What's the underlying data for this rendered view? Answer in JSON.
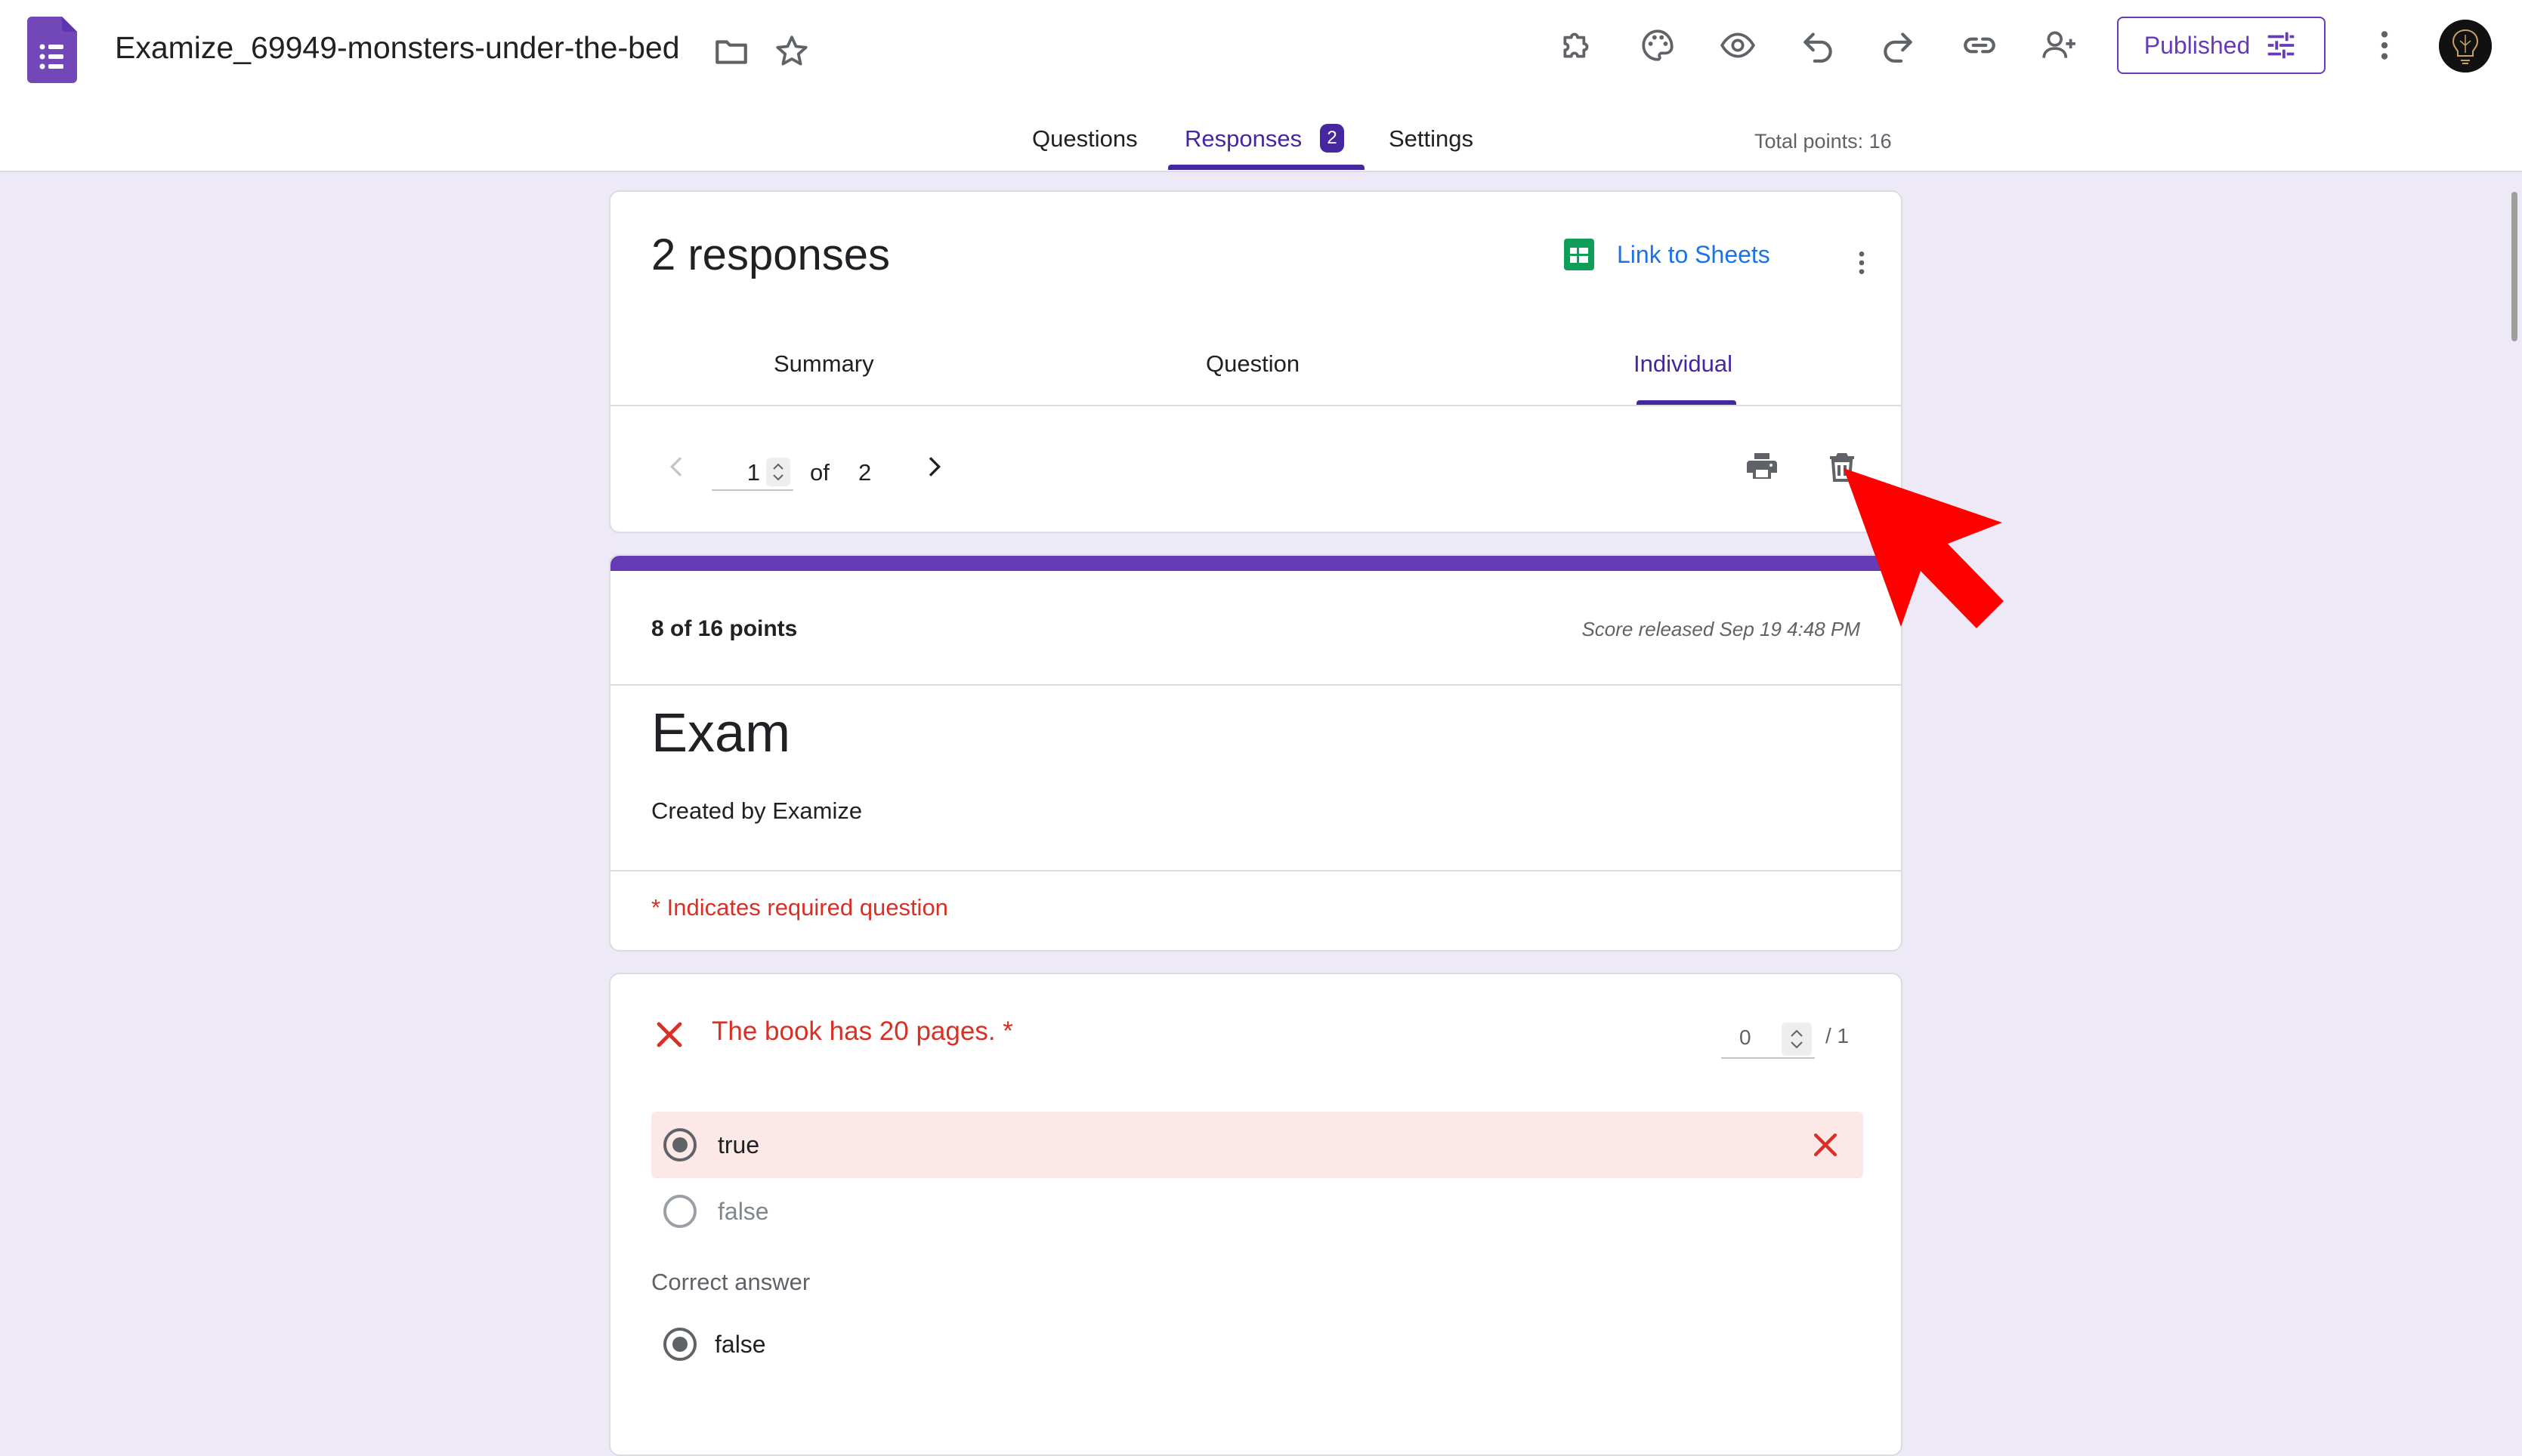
{
  "header": {
    "doc_title": "Examize_69949-monsters-under-the-bed",
    "published_label": "Published",
    "total_points": "Total points: 16"
  },
  "tabs": [
    {
      "label": "Questions"
    },
    {
      "label": "Responses",
      "badge": "2"
    },
    {
      "label": "Settings"
    }
  ],
  "responses_card": {
    "title": "2 responses",
    "link_sheets": "Link to Sheets",
    "subtabs": [
      "Summary",
      "Question",
      "Individual"
    ],
    "active_subtab": "Individual",
    "pager": {
      "current": "1",
      "of_label": "of",
      "total": "2"
    }
  },
  "score_card": {
    "points": "8 of 16 points",
    "released": "Score released Sep 19 4:48 PM",
    "title": "Exam",
    "subtitle": "Created by Examize",
    "required_note": "* Indicates required question"
  },
  "question": {
    "text": "The book has 20 pages. *",
    "score": "0",
    "max": "/ 1",
    "options": [
      {
        "label": "true",
        "selected": true,
        "status": "wrong"
      },
      {
        "label": "false",
        "selected": false
      }
    ],
    "correct_heading": "Correct answer",
    "correct_answer": "false"
  },
  "colors": {
    "accent": "#673ab7",
    "accent_dark": "#4527a0",
    "background": "#ede9f7",
    "error": "#d93025",
    "link": "#1a73e8",
    "sheets_green": "#0f9d58",
    "arrow": "#ff0000"
  },
  "icons": [
    "forms-logo-icon",
    "folder-icon",
    "star-icon",
    "addon-puzzle-icon",
    "palette-icon",
    "preview-eye-icon",
    "undo-icon",
    "redo-icon",
    "link-icon",
    "add-collaborator-icon",
    "tune-icon",
    "more-vert-icon",
    "sheets-icon",
    "chevron-left-icon",
    "chevron-right-icon",
    "print-icon",
    "trash-icon",
    "close-x-icon",
    "pointer-arrow-icon"
  ]
}
